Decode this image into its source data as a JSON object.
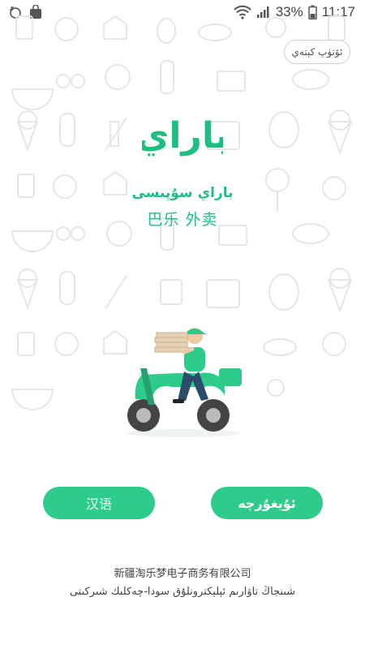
{
  "status_bar": {
    "battery_percent": "33%",
    "time": "11:17",
    "icons": [
      "snooze-icon",
      "shopping-bag-icon",
      "wifi-icon",
      "signal-icon",
      "battery-icon"
    ]
  },
  "skip_label": "ئۆتۈپ كېتەي",
  "brand": {
    "logo_text": "باراي",
    "uyghur_name": "باراي سۇپىسى",
    "chinese_name": "巴乐 外卖"
  },
  "language_buttons": {
    "chinese": "汉语",
    "uyghur": "ئۇيغۇرچە"
  },
  "footer": {
    "company_chinese": "新疆淘乐梦电子商务有限公司",
    "company_uyghur": "شىنجاڭ تاۋارىم ئېلېكترونلۇق سودا-چەكلىك شىركىتى"
  },
  "colors": {
    "accent": "#2ecc8a",
    "brand_text": "#1fbf83",
    "pattern": "#e8e8e8"
  }
}
